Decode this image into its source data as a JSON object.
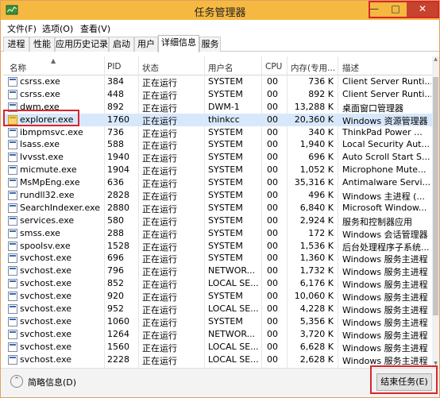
{
  "window": {
    "title": "任务管理器",
    "controls": {
      "minimize": "—",
      "maximize": "□",
      "close": "✕"
    }
  },
  "menu": [
    "文件(F)",
    "选项(O)",
    "查看(V)"
  ],
  "tabs": [
    "进程",
    "性能",
    "应用历史记录",
    "启动",
    "用户",
    "详细信息",
    "服务"
  ],
  "active_tab": "详细信息",
  "columns": [
    "名称",
    "PID",
    "状态",
    "用户名",
    "CPU",
    "内存(专用...",
    "描述"
  ],
  "rows": [
    {
      "name": "csrss.exe",
      "pid": "384",
      "status": "正在运行",
      "user": "SYSTEM",
      "cpu": "00",
      "mem": "736 K",
      "desc": "Client Server Runti..."
    },
    {
      "name": "csrss.exe",
      "pid": "448",
      "status": "正在运行",
      "user": "SYSTEM",
      "cpu": "00",
      "mem": "892 K",
      "desc": "Client Server Runti..."
    },
    {
      "name": "dwm.exe",
      "pid": "892",
      "status": "正在运行",
      "user": "DWM-1",
      "cpu": "00",
      "mem": "13,288 K",
      "desc": "桌面窗口管理器"
    },
    {
      "name": "explorer.exe",
      "pid": "1760",
      "status": "正在运行",
      "user": "thinkcc",
      "cpu": "00",
      "mem": "20,360 K",
      "desc": "Windows 资源管理器"
    },
    {
      "name": "ibmpmsvc.exe",
      "pid": "736",
      "status": "正在运行",
      "user": "SYSTEM",
      "cpu": "00",
      "mem": "340 K",
      "desc": "ThinkPad Power ..."
    },
    {
      "name": "lsass.exe",
      "pid": "588",
      "status": "正在运行",
      "user": "SYSTEM",
      "cpu": "00",
      "mem": "1,940 K",
      "desc": "Local Security Aut..."
    },
    {
      "name": "lvvsst.exe",
      "pid": "1940",
      "status": "正在运行",
      "user": "SYSTEM",
      "cpu": "00",
      "mem": "696 K",
      "desc": "Auto Scroll Start S..."
    },
    {
      "name": "micmute.exe",
      "pid": "1904",
      "status": "正在运行",
      "user": "SYSTEM",
      "cpu": "00",
      "mem": "1,052 K",
      "desc": "Microphone Mute..."
    },
    {
      "name": "MsMpEng.exe",
      "pid": "636",
      "status": "正在运行",
      "user": "SYSTEM",
      "cpu": "00",
      "mem": "35,316 K",
      "desc": "Antimalware Servi..."
    },
    {
      "name": "rundll32.exe",
      "pid": "2828",
      "status": "正在运行",
      "user": "SYSTEM",
      "cpu": "00",
      "mem": "496 K",
      "desc": "Windows 主进程 (..."
    },
    {
      "name": "SearchIndexer.exe",
      "pid": "2880",
      "status": "正在运行",
      "user": "SYSTEM",
      "cpu": "00",
      "mem": "6,840 K",
      "desc": "Microsoft Window..."
    },
    {
      "name": "services.exe",
      "pid": "580",
      "status": "正在运行",
      "user": "SYSTEM",
      "cpu": "00",
      "mem": "2,924 K",
      "desc": "服务和控制器应用"
    },
    {
      "name": "smss.exe",
      "pid": "288",
      "status": "正在运行",
      "user": "SYSTEM",
      "cpu": "00",
      "mem": "172 K",
      "desc": "Windows 会话管理器"
    },
    {
      "name": "spoolsv.exe",
      "pid": "1528",
      "status": "正在运行",
      "user": "SYSTEM",
      "cpu": "00",
      "mem": "1,536 K",
      "desc": "后台处理程序子系统..."
    },
    {
      "name": "svchost.exe",
      "pid": "696",
      "status": "正在运行",
      "user": "SYSTEM",
      "cpu": "00",
      "mem": "1,360 K",
      "desc": "Windows 服务主进程"
    },
    {
      "name": "svchost.exe",
      "pid": "796",
      "status": "正在运行",
      "user": "NETWOR...",
      "cpu": "00",
      "mem": "1,732 K",
      "desc": "Windows 服务主进程"
    },
    {
      "name": "svchost.exe",
      "pid": "852",
      "status": "正在运行",
      "user": "LOCAL SE...",
      "cpu": "00",
      "mem": "6,176 K",
      "desc": "Windows 服务主进程"
    },
    {
      "name": "svchost.exe",
      "pid": "920",
      "status": "正在运行",
      "user": "SYSTEM",
      "cpu": "00",
      "mem": "10,060 K",
      "desc": "Windows 服务主进程"
    },
    {
      "name": "svchost.exe",
      "pid": "952",
      "status": "正在运行",
      "user": "LOCAL SE...",
      "cpu": "00",
      "mem": "4,228 K",
      "desc": "Windows 服务主进程"
    },
    {
      "name": "svchost.exe",
      "pid": "1060",
      "status": "正在运行",
      "user": "SYSTEM",
      "cpu": "00",
      "mem": "5,356 K",
      "desc": "Windows 服务主进程"
    },
    {
      "name": "svchost.exe",
      "pid": "1264",
      "status": "正在运行",
      "user": "NETWOR...",
      "cpu": "00",
      "mem": "3,720 K",
      "desc": "Windows 服务主进程"
    },
    {
      "name": "svchost.exe",
      "pid": "1560",
      "status": "正在运行",
      "user": "LOCAL SE...",
      "cpu": "00",
      "mem": "6,628 K",
      "desc": "Windows 服务主进程"
    },
    {
      "name": "svchost.exe",
      "pid": "2228",
      "status": "正在运行",
      "user": "LOCAL SE...",
      "cpu": "00",
      "mem": "2,628 K",
      "desc": "Windows 服务主进程"
    }
  ],
  "selected_row": "explorer.exe",
  "footer": {
    "fewer_details": "简略信息(D)",
    "end_task": "结束任务(E)"
  },
  "colors": {
    "titlebar": "#f5b942",
    "close_button": "#c7432f",
    "highlight_box": "#d8262b",
    "selection": "#d8e8fb"
  },
  "icons": {
    "app": "task-manager-icon",
    "process": "process-icon",
    "fewer_details": "chevron-up-icon"
  }
}
